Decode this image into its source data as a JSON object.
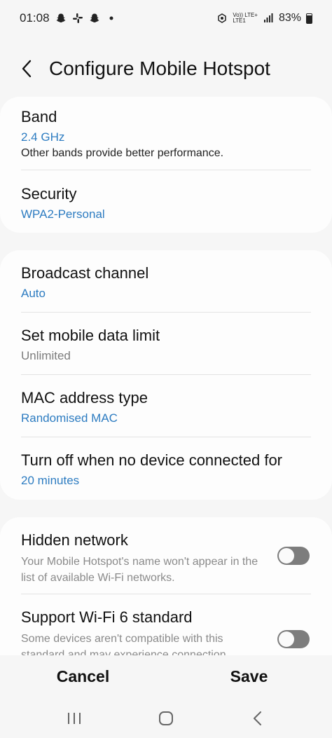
{
  "status_bar": {
    "time": "01:08",
    "network_top": "Vo)) LTE+",
    "network_bottom": "LTE1",
    "battery": "83%"
  },
  "header": {
    "title": "Configure Mobile Hotspot"
  },
  "section1": {
    "band": {
      "label": "Band",
      "value": "2.4 GHz",
      "description": "Other bands provide better performance."
    },
    "security": {
      "label": "Security",
      "value": "WPA2-Personal"
    }
  },
  "section2": {
    "broadcast_channel": {
      "label": "Broadcast channel",
      "value": "Auto"
    },
    "data_limit": {
      "label": "Set mobile data limit",
      "value": "Unlimited"
    },
    "mac_address": {
      "label": "MAC address type",
      "value": "Randomised MAC"
    },
    "turn_off": {
      "label": "Turn off when no device connected for",
      "value": "20 minutes"
    }
  },
  "section3": {
    "hidden_network": {
      "label": "Hidden network",
      "description": "Your Mobile Hotspot's name won't appear in the list of available Wi-Fi networks.",
      "enabled": false
    },
    "wifi6": {
      "label": "Support Wi-Fi 6 standard",
      "description": "Some devices aren't compatible with this standard and may experience connection",
      "enabled": false
    }
  },
  "actions": {
    "cancel": "Cancel",
    "save": "Save"
  },
  "navbar": {
    "icons": [
      "recents-icon",
      "home-icon",
      "back-icon"
    ]
  },
  "colors": {
    "accent": "#2d7cc1",
    "background": "#f6f6f6",
    "card": "#fdfdfd",
    "toggle_off": "#7d7d7d"
  }
}
